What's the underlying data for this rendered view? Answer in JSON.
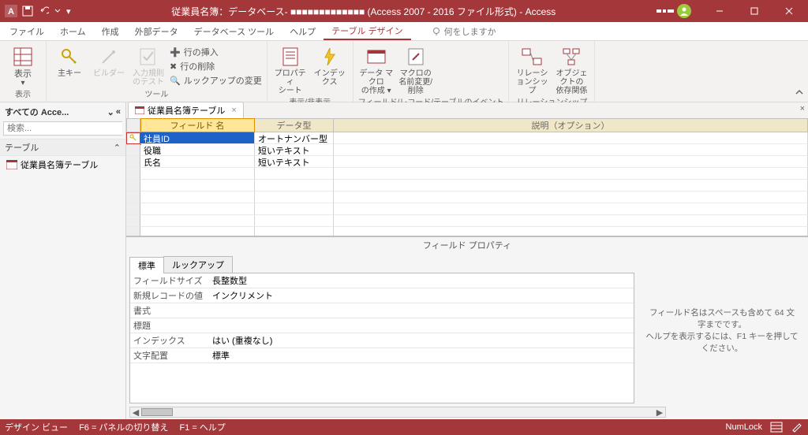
{
  "title": "従業員名簿：データベース- ■■■■■■■■■■■■■ (Access 2007 - 2016 ファイル形式)  -  Access",
  "ribbon_tabs": [
    "ファイル",
    "ホーム",
    "作成",
    "外部データ",
    "データベース ツール",
    "ヘルプ",
    "テーブル デザイン"
  ],
  "active_tab_index": 6,
  "tell_me_placeholder": "何をしますか",
  "ribbon_groups": {
    "view": {
      "btn": "表示",
      "label": "表示"
    },
    "tools": {
      "pk": "主キー",
      "builder": "ビルダー",
      "valid": "入力規則\nのテスト",
      "insert_row": "行の挿入",
      "delete_row": "行の削除",
      "modify_lookup": "ルックアップの変更",
      "label": "ツール"
    },
    "showhide": {
      "prop": "プロパティ\nシート",
      "index": "インデックス",
      "label": "表示/非表示"
    },
    "events": {
      "macro": "データ マクロ\nの作成 ▾",
      "rename": "マクロの\n名前変更/削除",
      "label": "フィールド/レコード/テーブルのイベント"
    },
    "rel": {
      "relation": "リレーションシップ",
      "deps": "オブジェクトの\n依存関係",
      "label": "リレーションシップ"
    }
  },
  "nav": {
    "header": "すべての Acce...",
    "search_placeholder": "検索...",
    "section": "テーブル",
    "items": [
      {
        "label": "従業員名簿テーブル"
      }
    ]
  },
  "doc_tab": "従業員名簿テーブル",
  "design_cols": {
    "field": "フィールド 名",
    "dtype": "データ型",
    "desc": "説明（オプション）"
  },
  "design_rows": [
    {
      "field": "社員ID",
      "dtype": "オートナンバー型",
      "pk": true,
      "selected": true
    },
    {
      "field": "役職",
      "dtype": "短いテキスト"
    },
    {
      "field": "氏名",
      "dtype": "短いテキスト"
    }
  ],
  "prop_header": "フィールド プロパティ",
  "prop_tabs": [
    "標準",
    "ルックアップ"
  ],
  "prop_active_tab": 0,
  "props": [
    {
      "n": "フィールドサイズ",
      "v": "長整数型"
    },
    {
      "n": "新規レコードの値",
      "v": "インクリメント"
    },
    {
      "n": "書式",
      "v": ""
    },
    {
      "n": "標題",
      "v": ""
    },
    {
      "n": "インデックス",
      "v": "はい (重複なし)"
    },
    {
      "n": "文字配置",
      "v": "標準"
    }
  ],
  "prop_help": "フィールド名はスペースも含めて 64 文字までです。\nヘルプを表示するには、F1 キーを押してください。",
  "status": {
    "view": "デザイン ビュー",
    "f6": "F6 = パネルの切り替え",
    "f1": "F1 = ヘルプ",
    "numlock": "NumLock"
  }
}
